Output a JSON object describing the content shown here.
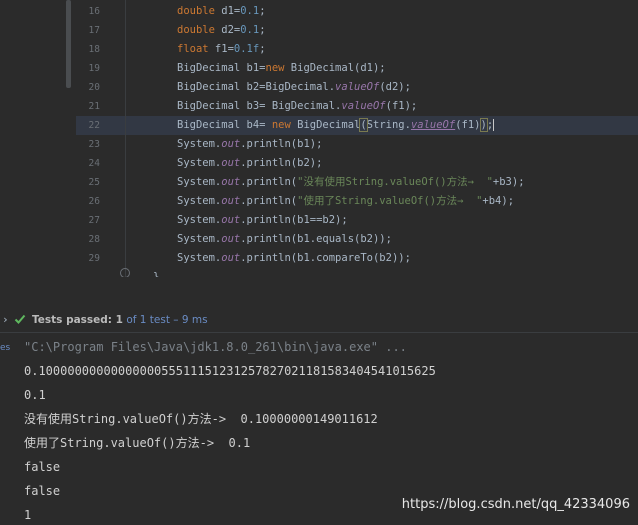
{
  "editor": {
    "line_numbers": [
      "16",
      "17",
      "18",
      "19",
      "20",
      "21",
      "22",
      "23",
      "24",
      "25",
      "26",
      "27",
      "28",
      "29"
    ],
    "lines": {
      "l16": {
        "kw": "double",
        "rest": " d1=",
        "num": "0.1",
        ";": ";"
      },
      "l17": {
        "kw": "double",
        "rest": " d2=",
        "num": "0.1",
        ";": ";"
      },
      "l18": {
        "kw": "float",
        "rest": " f1=",
        "num": "0.1f",
        ";": ";"
      },
      "l19": {
        "a": "BigDecimal b1=",
        "kw": "new",
        "b": " BigDecimal(d1);"
      },
      "l20": {
        "a": "BigDecimal b2=BigDecimal.",
        "fn": "valueOf",
        "b": "(d2);"
      },
      "l21": {
        "a": "BigDecimal b3= BigDecimal.",
        "fn": "valueOf",
        "b": "(f1);"
      },
      "l22": {
        "a": "BigDecimal b4= ",
        "kw": "new",
        "b": " BigDecimal",
        "p1": "(",
        "c": "String.",
        "fn": "valueOf",
        "d": "(f1)",
        "p2": ")",
        ";": ";"
      },
      "l23": {
        "a": "System.",
        "out": "out",
        "b": ".println(b1);"
      },
      "l24": {
        "a": "System.",
        "out": "out",
        "b": ".println(b2);"
      },
      "l25": {
        "a": "System.",
        "out": "out",
        "b": ".println(",
        "s": "\"没有使用String.valueOf()方法→  \"",
        "c": "+b3);"
      },
      "l26": {
        "a": "System.",
        "out": "out",
        "b": ".println(",
        "s": "\"使用了String.valueOf()方法→  \"",
        "c": "+b4);"
      },
      "l27": {
        "a": "System.",
        "out": "out",
        "b": ".println(b1==b2);"
      },
      "l28": {
        "a": "System.",
        "out": "out",
        "b": ".println(b1.equals(b2));"
      },
      "l29": {
        "a": "System.",
        "out": "out",
        "b": ".println(b1.compareTo(b2));"
      },
      "l30": {
        "a": "}"
      }
    }
  },
  "status": {
    "label": "Tests passed: ",
    "passed": "1",
    "of": " of 1 test",
    "time": " – 9 ms"
  },
  "console": {
    "tab_label": "es",
    "command": "\"C:\\Program Files\\Java\\jdk1.8.0_261\\bin\\java.exe\" ...",
    "output": [
      "0.1000000000000000055511151231257827021181583404541015625",
      "0.1",
      "没有使用String.valueOf()方法->  0.10000000149011612",
      "使用了String.valueOf()方法->  0.1",
      "false",
      "false",
      "1"
    ]
  },
  "watermark": "https://blog.csdn.net/qq_42334096",
  "icons": {
    "check": "check-icon",
    "expand": "chevron-right-icon"
  },
  "colors": {
    "background": "#2b2b2b",
    "keyword": "#cc7832",
    "number": "#6897bb",
    "string": "#6a8759",
    "field": "#9876aa",
    "pass": "#5fb85f"
  }
}
